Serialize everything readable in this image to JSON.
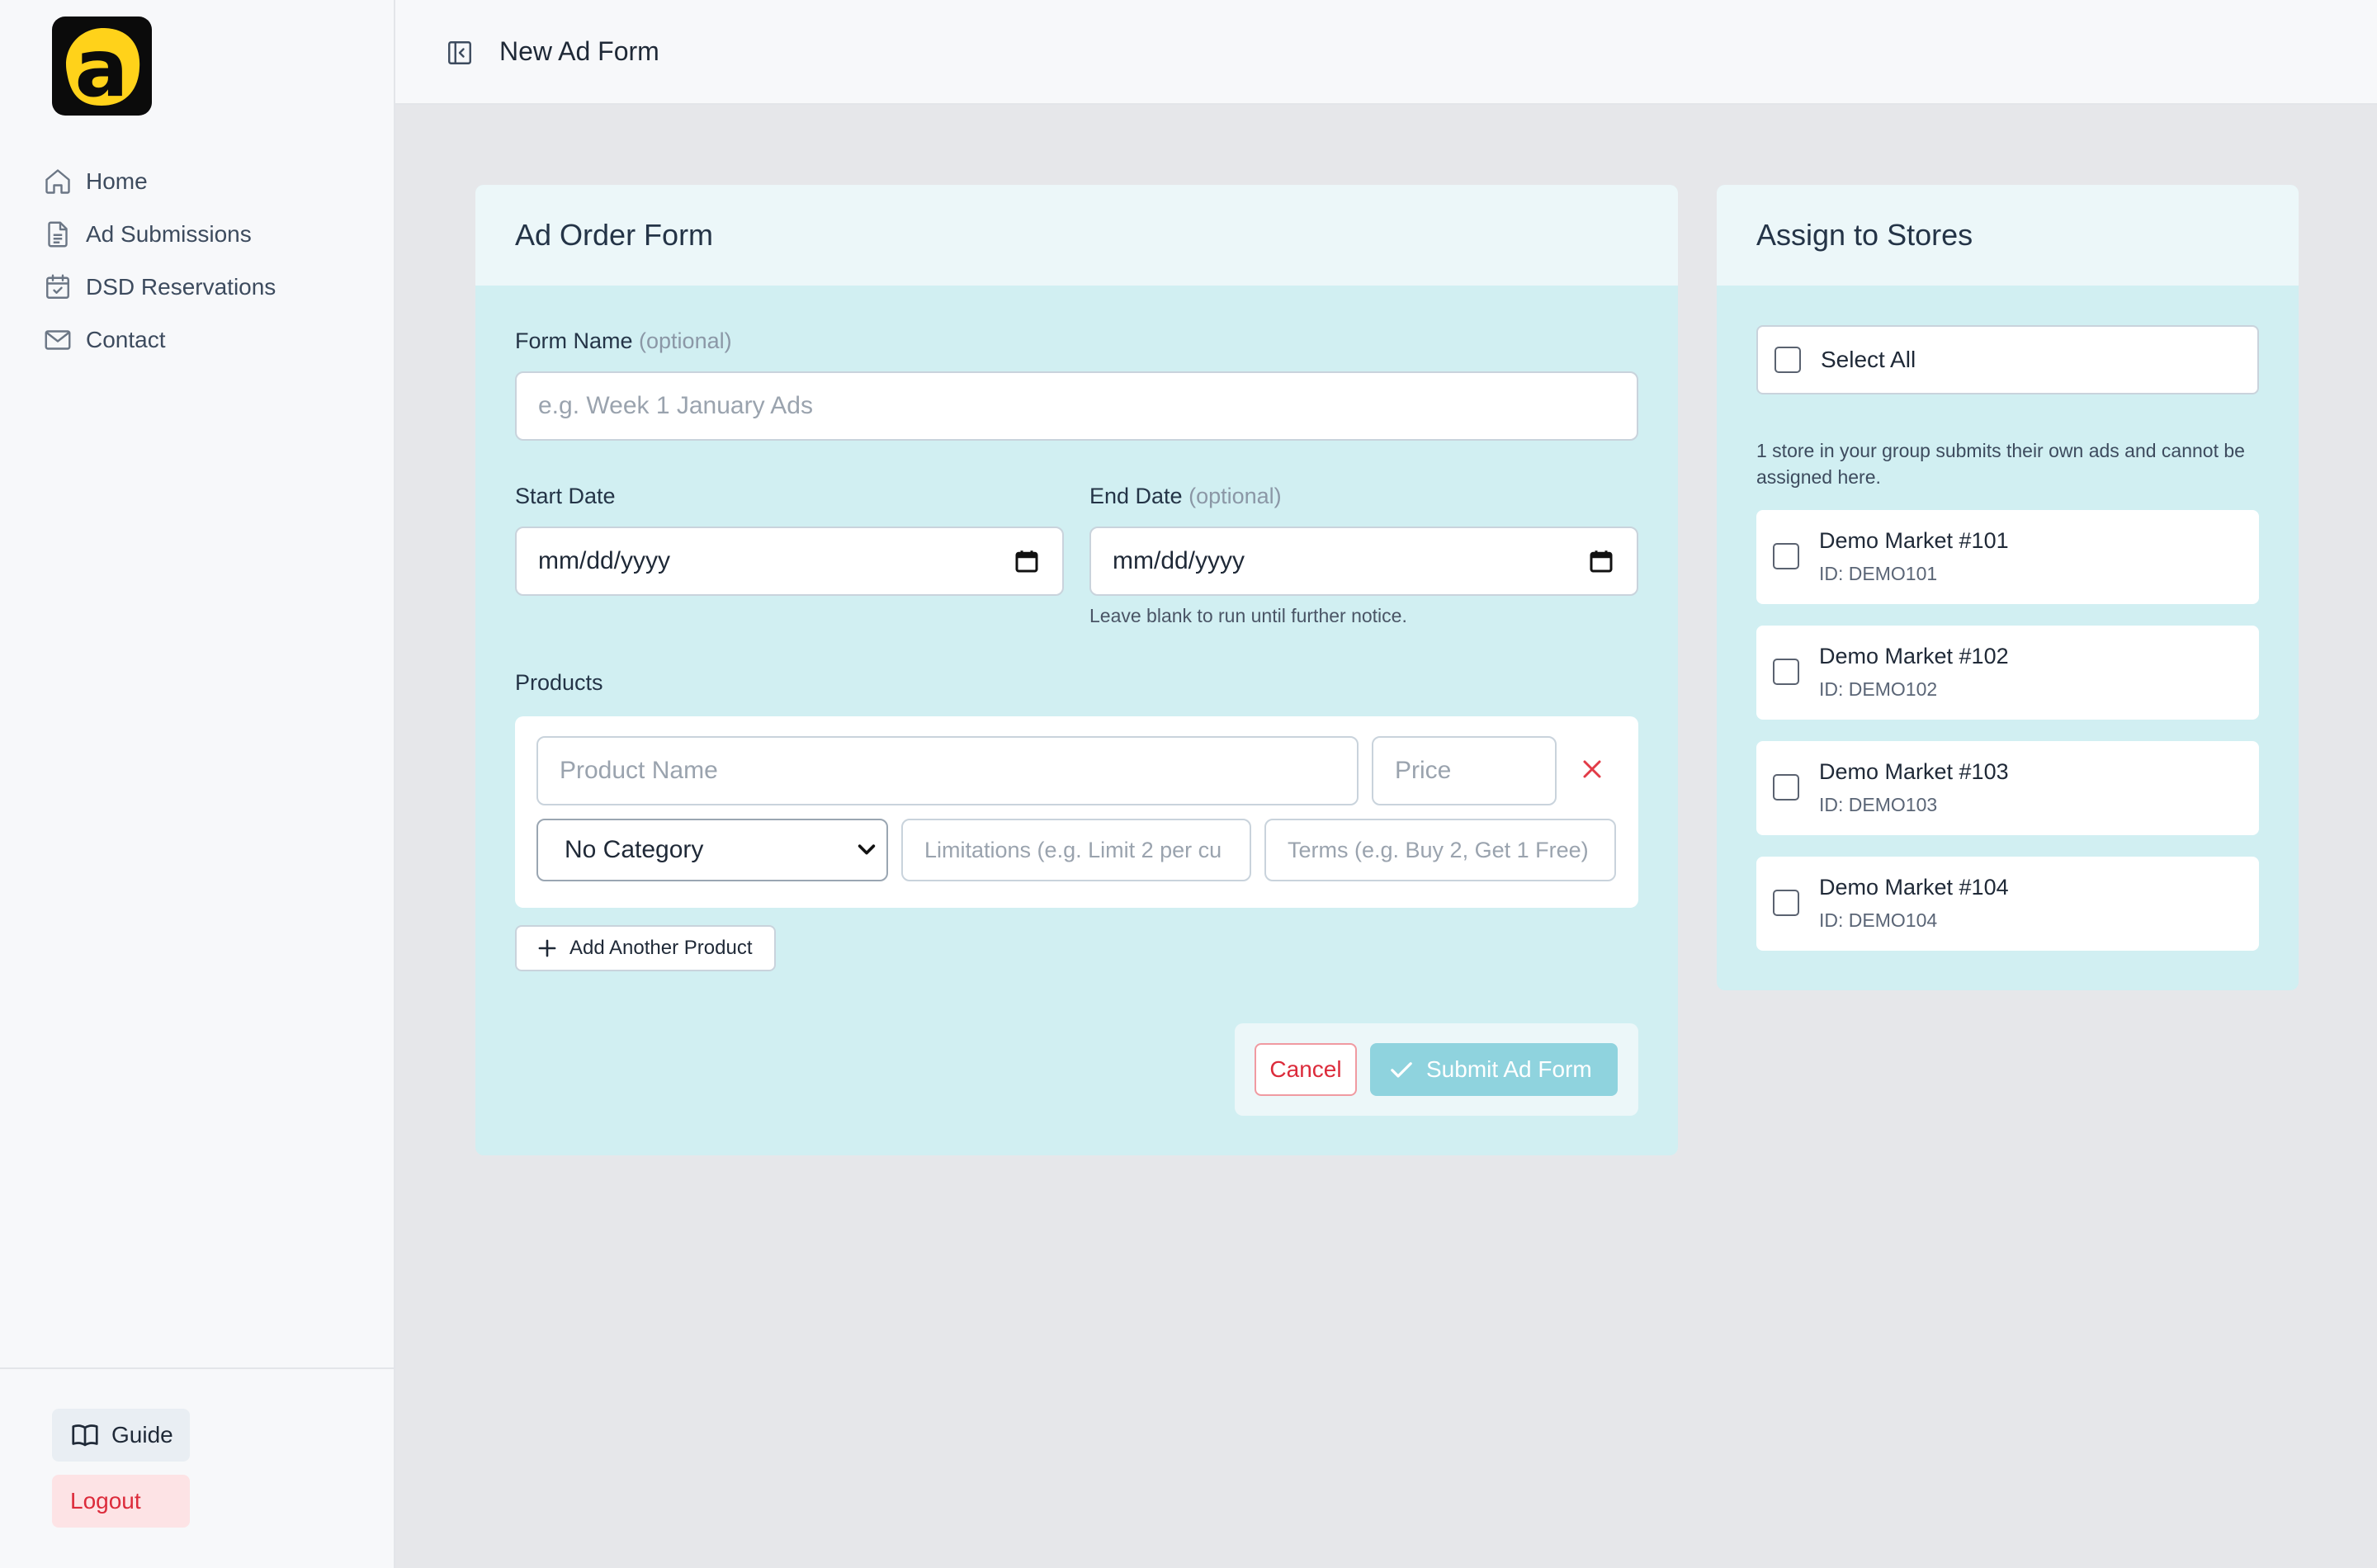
{
  "sidebar": {
    "logo_letter": "a",
    "nav": [
      {
        "label": "Home",
        "icon": "home-icon"
      },
      {
        "label": "Ad Submissions",
        "icon": "document-icon"
      },
      {
        "label": "DSD Reservations",
        "icon": "calendar-check-icon"
      },
      {
        "label": "Contact",
        "icon": "mail-icon"
      }
    ],
    "guide_label": "Guide",
    "logout_label": "Logout"
  },
  "header": {
    "title": "New Ad Form"
  },
  "form": {
    "title": "Ad Order Form",
    "form_name_label": "Form Name",
    "optional": "(optional)",
    "form_name_placeholder": "e.g. Week 1 January Ads",
    "start_date_label": "Start Date",
    "end_date_label": "End Date",
    "date_placeholder": "mm/dd/yyyy",
    "end_date_hint": "Leave blank to run until further notice.",
    "products_label": "Products",
    "product_name_placeholder": "Product Name",
    "price_placeholder": "Price",
    "category_selected": "No Category",
    "limitations_placeholder": "Limitations (e.g. Limit 2 per cu",
    "terms_placeholder": "Terms (e.g. Buy 2, Get 1 Free)",
    "add_product_label": "Add Another Product",
    "cancel_label": "Cancel",
    "submit_label": "Submit Ad Form"
  },
  "stores": {
    "title": "Assign to Stores",
    "select_all_label": "Select All",
    "note": "1 store in your group submits their own ads and cannot be assigned here.",
    "items": [
      {
        "name": "Demo Market #101",
        "id": "ID: DEMO101"
      },
      {
        "name": "Demo Market #102",
        "id": "ID: DEMO102"
      },
      {
        "name": "Demo Market #103",
        "id": "ID: DEMO103"
      },
      {
        "name": "Demo Market #104",
        "id": "ID: DEMO104"
      }
    ]
  },
  "colors": {
    "accent": "#8fd3de",
    "danger": "#dc2b3b",
    "logo_yellow": "#ffd21a",
    "card_bg": "#d1eff2"
  }
}
